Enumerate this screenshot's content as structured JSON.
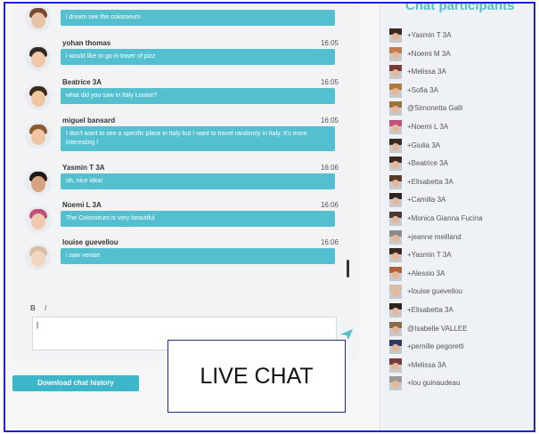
{
  "chat": {
    "messages": [
      {
        "name": "",
        "time": "",
        "text": "i dream see the colosseum",
        "hair": "#7a4a2e",
        "face": "#e7c3a7"
      },
      {
        "name": "yohan thomas",
        "time": "16:05",
        "text": "i would like to go in tower of pizz",
        "hair": "#2f2a24",
        "face": "#f0c7a8"
      },
      {
        "name": "Beatrice 3A",
        "time": "16:05",
        "text": "what did you saw in Italy Louise?",
        "hair": "#3b2a1d",
        "face": "#f0c6a1"
      },
      {
        "name": "miguel bansard",
        "time": "16:05",
        "text": "I don't want to see a specific place in Italy but I want to travel randomly in Italy. It's more interesting !",
        "hair": "#8a5a33",
        "face": "#efc5a4"
      },
      {
        "name": "Yasmin T 3A",
        "time": "16:06",
        "text": "oh, nice idea!",
        "hair": "#1f1a18",
        "face": "#d6a27f"
      },
      {
        "name": "Noemi L 3A",
        "time": "16:06",
        "text": "The Colosseum is very beautiful",
        "hair": "#c1507b",
        "face": "#f1c9b0"
      },
      {
        "name": "louise guevellou",
        "time": "16:06",
        "text": "i saw venise",
        "hair": "#d5bfa6",
        "face": "#f2d6c0"
      }
    ],
    "format_tools": [
      "B",
      "I"
    ],
    "input_value": "|",
    "download_label": "Download chat history"
  },
  "overlay": {
    "live_chat_label": "LIVE CHAT"
  },
  "participants": {
    "title": "Chat participants",
    "list": [
      {
        "name": "+Yasmin T 3A",
        "color": "#3a2a20"
      },
      {
        "name": "+Noemi M 3A",
        "color": "#c47a4a"
      },
      {
        "name": "+Melissa 3A",
        "color": "#7a3a3a"
      },
      {
        "name": "+Sofia 3A",
        "color": "#b07a3a"
      },
      {
        "name": "@Simonetta Galli",
        "color": "#a0703a"
      },
      {
        "name": "+Noemi L 3A",
        "color": "#c1507b"
      },
      {
        "name": "+Giulia 3A",
        "color": "#3a2a20"
      },
      {
        "name": "+Beatrice 3A",
        "color": "#3b2a1d"
      },
      {
        "name": "+Elisabetta 3A",
        "color": "#5a3a2a"
      },
      {
        "name": "+Camilla 3A",
        "color": "#2e2622"
      },
      {
        "name": "+Monica Gianna Fucina",
        "color": "#4a3a30"
      },
      {
        "name": "+jeanne meilland",
        "color": "#8a8a8a"
      },
      {
        "name": "+Yasmin T 3A",
        "color": "#3a2a20"
      },
      {
        "name": "+Alessio 3A",
        "color": "#b0603a"
      },
      {
        "name": "+louise guevellou",
        "color": "#d5bfa6"
      },
      {
        "name": "+Elisabetta 3A",
        "color": "#2a2420"
      },
      {
        "name": "@Isabelle VALLEE",
        "color": "#8a6a4a"
      },
      {
        "name": "+pernille pegoretti",
        "color": "#2a3a6a"
      },
      {
        "name": "+Melissa 3A",
        "color": "#7a3a3a"
      },
      {
        "name": "+lou guinaudeau",
        "color": "#9a9a9a"
      }
    ]
  },
  "colors": {
    "accent": "#54c0cf",
    "frame": "#1f1fd6"
  },
  "icons": {
    "send": "send-arrow-icon"
  }
}
